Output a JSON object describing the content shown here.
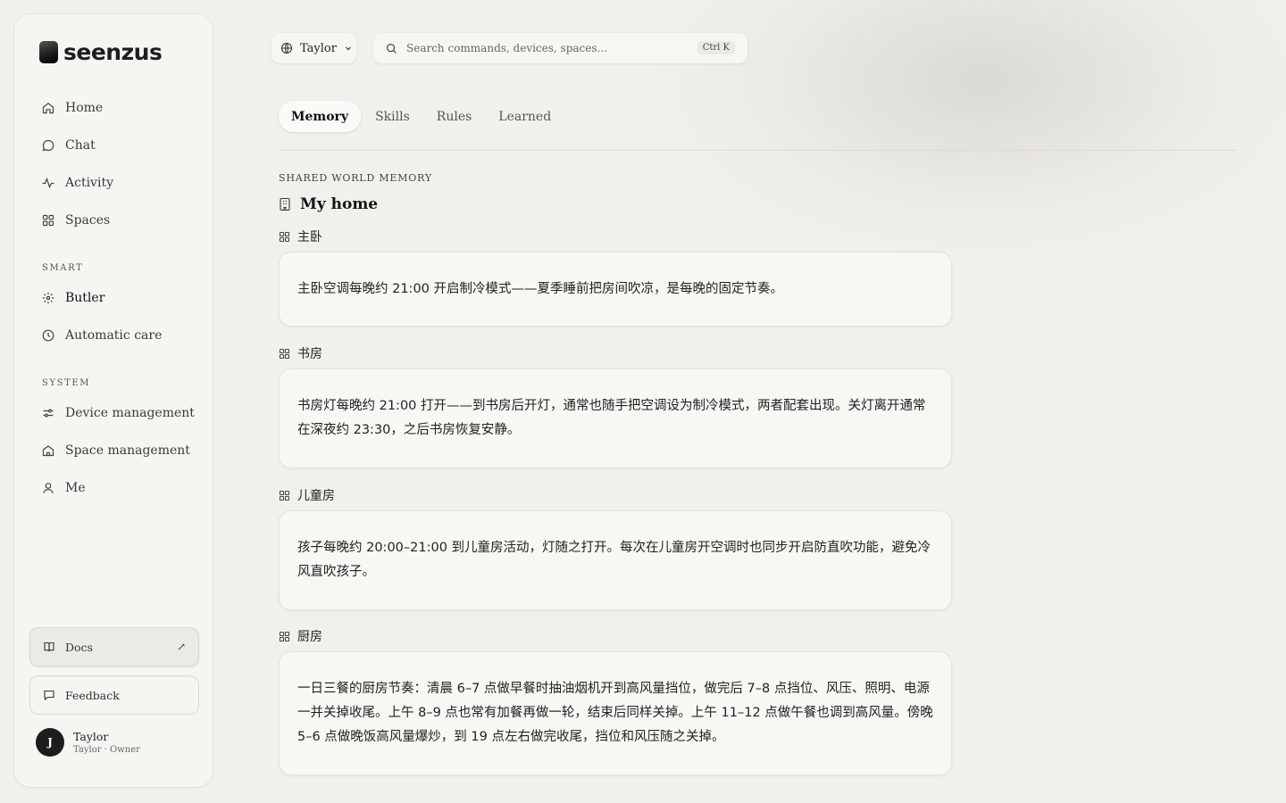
{
  "brand": {
    "name": "seenzus"
  },
  "nav": {
    "main": [
      {
        "label": "Home",
        "icon": "home-icon"
      },
      {
        "label": "Chat",
        "icon": "chat-icon"
      },
      {
        "label": "Activity",
        "icon": "activity-icon"
      },
      {
        "label": "Spaces",
        "icon": "grid-icon"
      }
    ],
    "smart_label": "SMART",
    "smart": [
      {
        "label": "Butler",
        "icon": "sparkle-icon",
        "active": true
      },
      {
        "label": "Automatic care",
        "icon": "clock-icon"
      }
    ],
    "system_label": "SYSTEM",
    "system": [
      {
        "label": "Device management",
        "icon": "sliders-icon"
      },
      {
        "label": "Space management",
        "icon": "building-icon"
      },
      {
        "label": "Me",
        "icon": "user-icon"
      }
    ]
  },
  "sidebar_footer": {
    "docs_label": "Docs",
    "docs_arrow": "↗",
    "feedback_label": "Feedback",
    "user": {
      "initial": "J",
      "name": "Taylor",
      "role": "Taylor · Owner"
    }
  },
  "topbar": {
    "space_name": "Taylor",
    "search_placeholder": "Search commands, devices, spaces…",
    "search_shortcut": "Ctrl K"
  },
  "tabs": [
    {
      "label": "Memory",
      "active": true
    },
    {
      "label": "Skills"
    },
    {
      "label": "Rules"
    },
    {
      "label": "Learned"
    }
  ],
  "memory": {
    "eyebrow": "SHARED WORLD MEMORY",
    "home_title": "My home",
    "rooms": [
      {
        "name": "主卧",
        "text": "主卧空调每晚约 21:00 开启制冷模式——夏季睡前把房间吹凉，是每晚的固定节奏。"
      },
      {
        "name": "书房",
        "text": "书房灯每晚约 21:00 打开——到书房后开灯，通常也随手把空调设为制冷模式，两者配套出现。关灯离开通常在深夜约 23:30，之后书房恢复安静。"
      },
      {
        "name": "儿童房",
        "text": "孩子每晚约 20:00–21:00 到儿童房活动，灯随之打开。每次在儿童房开空调时也同步开启防直吹功能，避免冷风直吹孩子。"
      },
      {
        "name": "厨房",
        "text": "一日三餐的厨房节奏：清晨 6–7 点做早餐时抽油烟机开到高风量挡位，做完后 7–8 点挡位、风压、照明、电源一并关掉收尾。上午 8–9 点也常有加餐再做一轮，结束后同样关掉。上午 11–12 点做午餐也调到高风量。傍晚 5–6 点做晚饭高风量爆炒，到 19 点左右做完收尾，挡位和风压随之关掉。"
      }
    ]
  }
}
